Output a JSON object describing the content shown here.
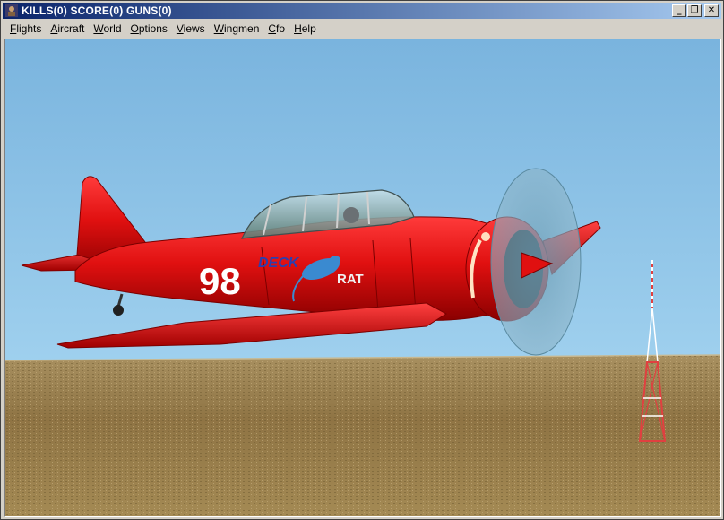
{
  "window": {
    "title": "KILLS(0) SCORE(0) GUNS(0)",
    "controls": {
      "minimize": "_",
      "restore": "❐",
      "close": "✕"
    }
  },
  "menu": [
    {
      "label": "Flights",
      "accel": "F",
      "rest": "lights"
    },
    {
      "label": "Aircraft",
      "accel": "A",
      "rest": "ircraft"
    },
    {
      "label": "World",
      "accel": "W",
      "rest": "orld"
    },
    {
      "label": "Options",
      "accel": "O",
      "rest": "ptions"
    },
    {
      "label": "Views",
      "accel": "V",
      "rest": "iews"
    },
    {
      "label": "Wingmen",
      "accel": "W",
      "rest": "ingmen"
    },
    {
      "label": "Cfo",
      "accel": "C",
      "rest": "fo"
    },
    {
      "label": "Help",
      "accel": "H",
      "rest": "elp"
    }
  ],
  "scene": {
    "aircraft_number": "98",
    "nose_art_top": "DECK",
    "nose_art_bottom": "RAT",
    "colors": {
      "sky": "#87bfe0",
      "ground": "#9c8450",
      "aircraft": "#e01010",
      "tower": "#e04040"
    }
  }
}
